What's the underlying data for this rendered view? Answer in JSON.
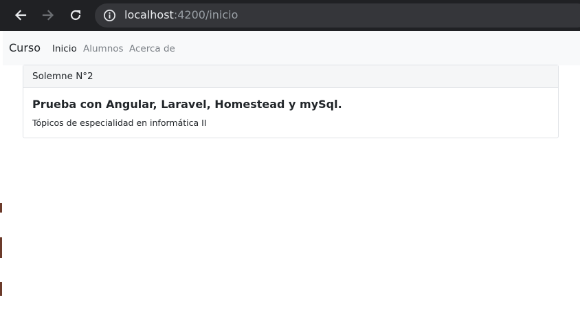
{
  "browser": {
    "url_host": "localhost",
    "url_path": ":4200/inicio",
    "back_icon": "arrow-left-icon",
    "forward_icon": "arrow-right-icon",
    "reload_icon": "reload-icon",
    "site_info_icon": "info-icon"
  },
  "navbar": {
    "brand": "Curso",
    "links": [
      {
        "label": "Inicio",
        "active": true
      },
      {
        "label": "Alumnos",
        "active": false
      },
      {
        "label": "Acerca de",
        "active": false
      }
    ]
  },
  "card": {
    "header": "Solemne N°2",
    "title": "Prueba con Angular, Laravel, Homestead y mySql.",
    "text": "Tópicos de especialidad en informática II"
  },
  "colors": {
    "browser_bar": "#202124",
    "url_box": "#35363a",
    "navbar_bg": "#f8f9fa",
    "card_header_bg": "#f5f6f7",
    "card_border": "#dfe2e6"
  }
}
